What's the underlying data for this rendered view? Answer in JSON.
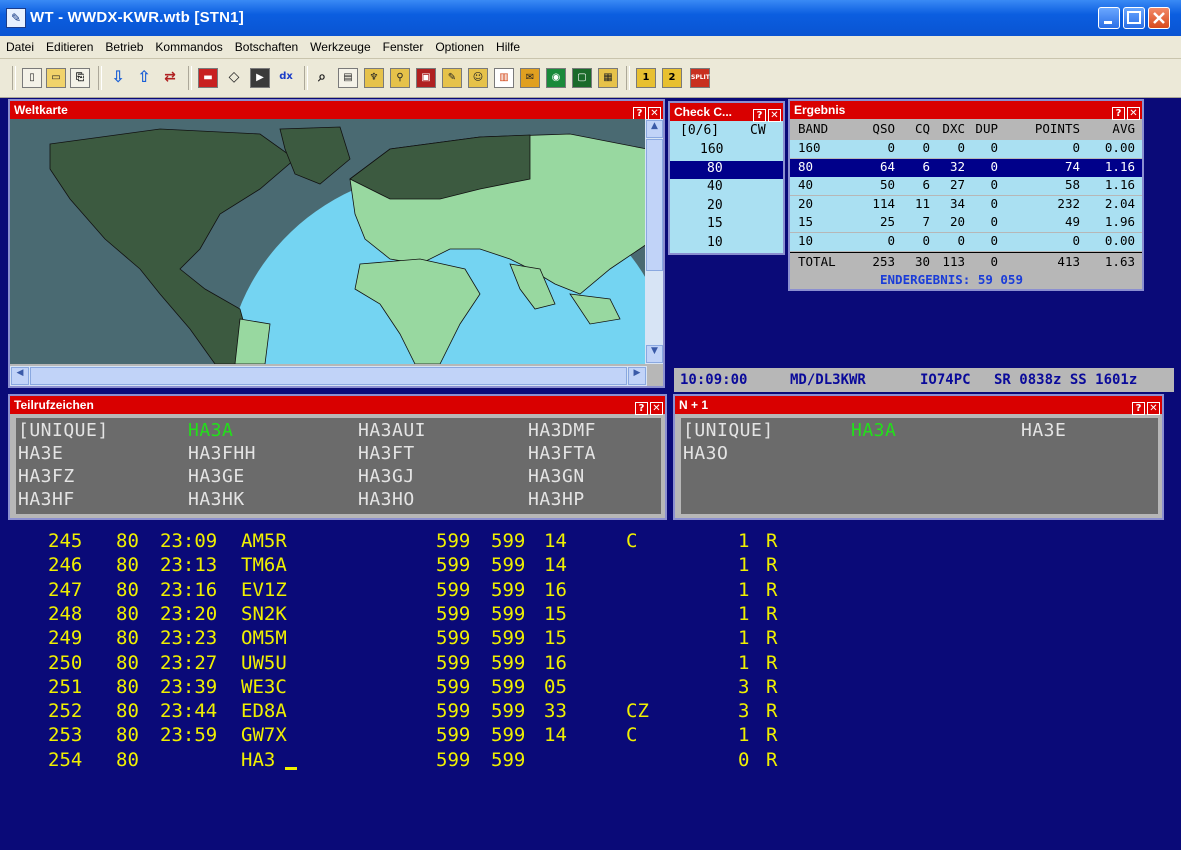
{
  "window": {
    "title": "WT - WWDX-KWR.wtb [STN1]",
    "icon": "antenna-icon"
  },
  "menu": [
    "Datei",
    "Editieren",
    "Betrieb",
    "Kommandos",
    "Botschaften",
    "Werkzeuge",
    "Fenster",
    "Optionen",
    "Hilfe"
  ],
  "toolbar": {
    "dx_label": "dx",
    "btn1": "1",
    "btn2": "2",
    "split_label": "SPLIT"
  },
  "weltkarte": {
    "title": "Weltkarte"
  },
  "checkc": {
    "title": "Check C...",
    "header": {
      "count": "[0/6]",
      "mode": "CW"
    },
    "bands": [
      "160",
      "80",
      "40",
      "20",
      "15",
      "10"
    ],
    "selected": "80"
  },
  "ergebnis": {
    "title": "Ergebnis",
    "headers": [
      "BAND",
      "QSO",
      "CQ",
      "DXC",
      "DUP",
      "POINTS",
      "AVG"
    ],
    "rows": [
      [
        "160",
        "0",
        "0",
        "0",
        "0",
        "0",
        "0.00"
      ],
      [
        "80",
        "64",
        "6",
        "32",
        "0",
        "74",
        "1.16"
      ],
      [
        "40",
        "50",
        "6",
        "27",
        "0",
        "58",
        "1.16"
      ],
      [
        "20",
        "114",
        "11",
        "34",
        "0",
        "232",
        "2.04"
      ],
      [
        "15",
        "25",
        "7",
        "20",
        "0",
        "49",
        "1.96"
      ],
      [
        "10",
        "0",
        "0",
        "0",
        "0",
        "0",
        "0.00"
      ]
    ],
    "total": [
      "TOTAL",
      "253",
      "30",
      "113",
      "0",
      "413",
      "1.63"
    ],
    "endergebnis": "ENDERGEBNIS: 59 059"
  },
  "status": {
    "time": "10:09:00",
    "call": "MD/DL3KWR",
    "locator": "IO74PC",
    "sun": "SR 0838z SS 1601z"
  },
  "teilruf": {
    "title": "Teilrufzeichen",
    "calls": [
      "[UNIQUE]",
      "HA3A",
      "HA3AUI",
      "HA3DMF",
      "HA3E",
      "HA3FHH",
      "HA3FT",
      "HA3FTA",
      "HA3FZ",
      "HA3GE",
      "HA3GJ",
      "HA3GN",
      "HA3HF",
      "HA3HK",
      "HA3HO",
      "HA3HP"
    ],
    "highlight": "HA3A"
  },
  "nplus1": {
    "title": "N + 1",
    "calls": [
      "[UNIQUE]",
      "HA3A",
      "HA3E",
      "HA3O"
    ],
    "highlight": "HA3A"
  },
  "log": [
    {
      "nr": "245",
      "band": "80",
      "time": "23:09",
      "call": "AM5R",
      "rst_s": "599",
      "rst_r": "599",
      "zone": "14",
      "mult": "C",
      "pts": "1",
      "flag": "R"
    },
    {
      "nr": "246",
      "band": "80",
      "time": "23:13",
      "call": "TM6A",
      "rst_s": "599",
      "rst_r": "599",
      "zone": "14",
      "mult": "",
      "pts": "1",
      "flag": "R"
    },
    {
      "nr": "247",
      "band": "80",
      "time": "23:16",
      "call": "EV1Z",
      "rst_s": "599",
      "rst_r": "599",
      "zone": "16",
      "mult": "",
      "pts": "1",
      "flag": "R"
    },
    {
      "nr": "248",
      "band": "80",
      "time": "23:20",
      "call": "SN2K",
      "rst_s": "599",
      "rst_r": "599",
      "zone": "15",
      "mult": "",
      "pts": "1",
      "flag": "R"
    },
    {
      "nr": "249",
      "band": "80",
      "time": "23:23",
      "call": "OM5M",
      "rst_s": "599",
      "rst_r": "599",
      "zone": "15",
      "mult": "",
      "pts": "1",
      "flag": "R"
    },
    {
      "nr": "250",
      "band": "80",
      "time": "23:27",
      "call": "UW5U",
      "rst_s": "599",
      "rst_r": "599",
      "zone": "16",
      "mult": "",
      "pts": "1",
      "flag": "R"
    },
    {
      "nr": "251",
      "band": "80",
      "time": "23:39",
      "call": "WE3C",
      "rst_s": "599",
      "rst_r": "599",
      "zone": "05",
      "mult": "",
      "pts": "3",
      "flag": "R"
    },
    {
      "nr": "252",
      "band": "80",
      "time": "23:44",
      "call": "ED8A",
      "rst_s": "599",
      "rst_r": "599",
      "zone": "33",
      "mult": "CZ",
      "pts": "3",
      "flag": "R"
    },
    {
      "nr": "253",
      "band": "80",
      "time": "23:59",
      "call": "GW7X",
      "rst_s": "599",
      "rst_r": "599",
      "zone": "14",
      "mult": "C",
      "pts": "1",
      "flag": "R"
    },
    {
      "nr": "254",
      "band": "80",
      "time": "",
      "call": "HA3",
      "rst_s": "599",
      "rst_r": "599",
      "zone": "",
      "mult": "",
      "pts": "0",
      "flag": "R"
    }
  ],
  "colors": {
    "background": "#0a0a78",
    "panel_title": "#d90000",
    "log_text": "#f0f000",
    "highlight": "#22e01a"
  }
}
